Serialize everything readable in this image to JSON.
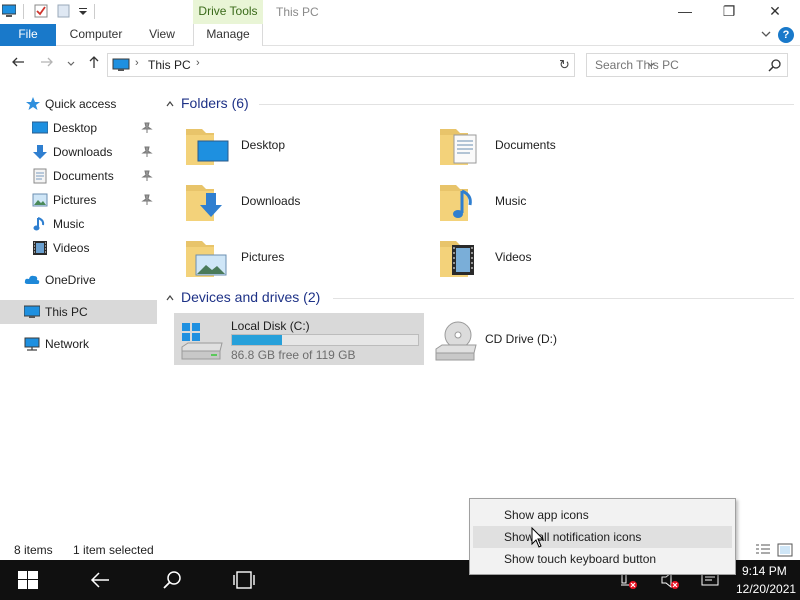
{
  "titlebar": {
    "context_tab": "Drive Tools",
    "title": "This PC",
    "minimize": "—",
    "maximize": "❐",
    "close": "✕"
  },
  "ribbon": {
    "tabs": [
      "File",
      "Computer",
      "View",
      "Manage"
    ],
    "help": "?"
  },
  "address_bar": {
    "path": "This PC",
    "chevron": "›",
    "refresh": "↻",
    "search_placeholder": "Search This PC"
  },
  "sidebar": {
    "items": [
      {
        "label": "Quick access",
        "icon": "star-icon"
      },
      {
        "label": "Desktop",
        "icon": "desktop-icon",
        "pinned": true
      },
      {
        "label": "Downloads",
        "icon": "download-icon",
        "pinned": true
      },
      {
        "label": "Documents",
        "icon": "document-icon",
        "pinned": true
      },
      {
        "label": "Pictures",
        "icon": "pictures-icon",
        "pinned": true
      },
      {
        "label": "Music",
        "icon": "music-icon"
      },
      {
        "label": "Videos",
        "icon": "videos-icon"
      },
      {
        "label": "OneDrive",
        "icon": "cloud-icon"
      },
      {
        "label": "This PC",
        "icon": "computer-icon",
        "selected": true
      },
      {
        "label": "Network",
        "icon": "network-icon"
      }
    ]
  },
  "content": {
    "folders_header": "Folders (6)",
    "folders": [
      "Desktop",
      "Documents",
      "Downloads",
      "Music",
      "Pictures",
      "Videos"
    ],
    "drives_header": "Devices and drives (2)",
    "drives": [
      {
        "name": "Local Disk (C:)",
        "free_text": "86.8 GB free of 119 GB",
        "used_fraction": 0.27,
        "selected": true
      },
      {
        "name": "CD Drive (D:)"
      }
    ]
  },
  "statusbar": {
    "count": "8 items",
    "selection": "1 item selected"
  },
  "context_menu": {
    "items": [
      "Show app icons",
      "Show all notification icons",
      "Show touch keyboard button"
    ],
    "hover_index": 1
  },
  "taskbar": {
    "time": "9:14 PM",
    "date": "12/20/2021"
  },
  "colors": {
    "accent": "#1979ca",
    "progress": "#26a0da",
    "header_text": "#1e3287",
    "context_tab_bg": "#e9f5d6"
  }
}
